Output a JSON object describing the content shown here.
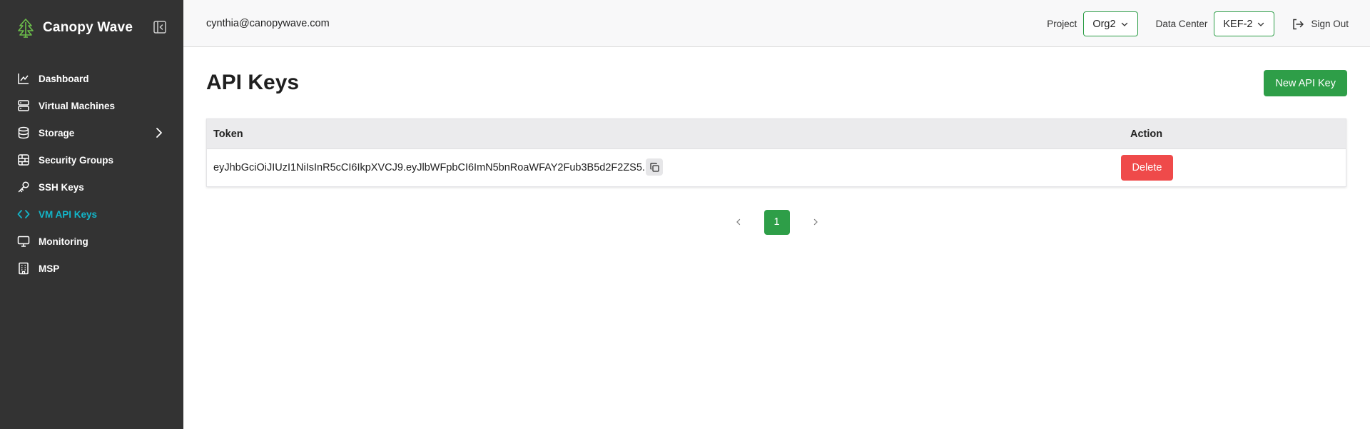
{
  "brand": {
    "name": "Canopy Wave"
  },
  "sidebar": {
    "items": [
      {
        "label": "Dashboard",
        "icon": "chart-line-icon"
      },
      {
        "label": "Virtual Machines",
        "icon": "server-icon"
      },
      {
        "label": "Storage",
        "icon": "database-icon",
        "has_submenu": true
      },
      {
        "label": "Security Groups",
        "icon": "firewall-grid-icon"
      },
      {
        "label": "SSH Keys",
        "icon": "key-icon"
      },
      {
        "label": "VM API Keys",
        "icon": "code-brackets-icon",
        "active": true
      },
      {
        "label": "Monitoring",
        "icon": "monitor-icon"
      },
      {
        "label": "MSP",
        "icon": "building-icon"
      }
    ]
  },
  "header": {
    "email": "cynthia@canopywave.com",
    "project_label": "Project",
    "project_value": "Org2",
    "datacenter_label": "Data Center",
    "datacenter_value": "KEF-2",
    "signout_label": "Sign Out"
  },
  "page": {
    "title": "API Keys",
    "new_button": "New API Key"
  },
  "table": {
    "columns": [
      "Token",
      "Action"
    ],
    "rows": [
      {
        "token": "eyJhbGciOiJIUzI1NiIsInR5cCI6IkpXVCJ9.eyJlbWFpbCI6ImN5bnRoaWFAY2Fub3B5d2F2ZS5...",
        "action": "Delete"
      }
    ]
  },
  "pagination": {
    "current": "1"
  },
  "colors": {
    "sidebar_bg": "#333333",
    "accent_green": "#2e9e48",
    "active_cyan": "#13b5c8",
    "danger_red": "#ef4a4a"
  }
}
